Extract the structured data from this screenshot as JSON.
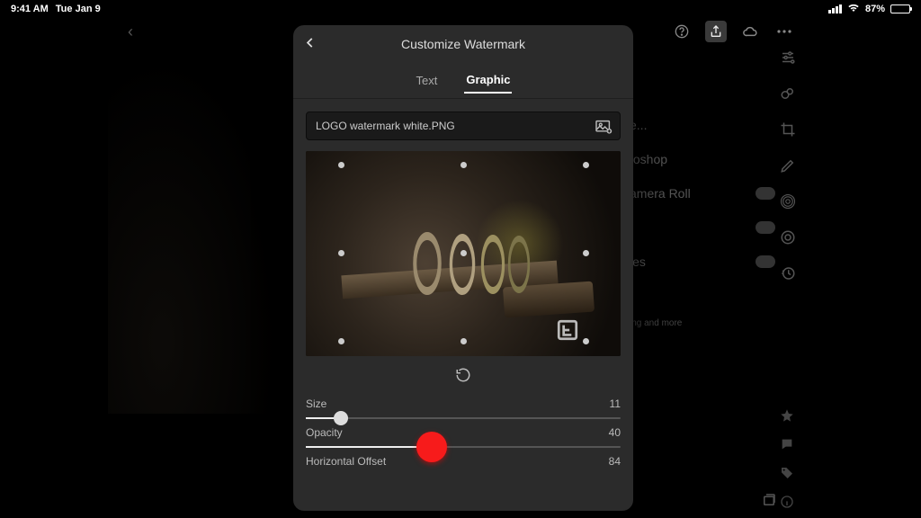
{
  "status": {
    "time": "9:41 AM",
    "date": "Tue Jan 9",
    "battery_pct": "87%"
  },
  "bg_menu": {
    "item1": "e...",
    "item2": "toshop",
    "item3": "amera Roll",
    "item4": "les",
    "note": "ing and more"
  },
  "modal": {
    "title": "Customize Watermark",
    "tabs": {
      "text": "Text",
      "graphic": "Graphic"
    },
    "file_name": "LOGO watermark white.PNG",
    "sliders": {
      "size": {
        "label": "Size",
        "value": "11",
        "pct": 11
      },
      "opacity": {
        "label": "Opacity",
        "value": "40",
        "pct": 40
      },
      "hoff": {
        "label": "Horizontal Offset",
        "value": "84",
        "pct": 84
      }
    }
  }
}
